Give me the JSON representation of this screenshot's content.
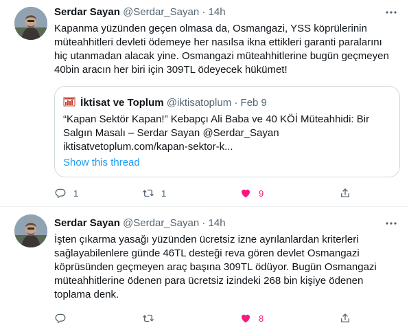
{
  "tweets": [
    {
      "author": "Serdar Sayan",
      "handle": "@Serdar_Sayan",
      "separator": "·",
      "time": "14h",
      "text": "Kapanma yüzünden geçen olmasa da, Osmangazi, YSS köprülerinin\nmüteahhitleri devleti ödemeye her nasılsa ikna ettikleri garanti paralarını\nhiç utanmadan alacak yine. Osmangazi müteahhitlerine bugün geçmeyen\n40bin aracın her biri için 309TL ödeyecek hükümet!",
      "quote": {
        "author": "İktisat ve Toplum",
        "handle": "@iktisatoplum",
        "separator": "·",
        "time": "Feb 9",
        "text": "“Kapan Sektör Kapan!” Kebapçı Ali Baba ve 40 KÖİ Müteahhidi: Bir\nSalgın Masalı – Serdar Sayan @Serdar_Sayan\niktisatvetoplum.com/kapan-sektor-k...",
        "thread_link": "Show this thread"
      },
      "reply_count": "1",
      "retweet_count": "1",
      "like_count": "9"
    },
    {
      "author": "Serdar Sayan",
      "handle": "@Serdar_Sayan",
      "separator": "·",
      "time": "14h",
      "text": "İşten çıkarma yasağı yüzünden ücretsiz izne ayrılanlardan kriterleri\nsağlayabilenlere günde 46TL desteği reva gören devlet Osmangazi\nköprüsünden geçmeyen araç başına 309TL ödüyor. Bugün Osmangazi\nmüteahhitlerine ödenen para ücretsiz izindeki 268 bin kişiye ödenen\ntoplama denk.",
      "reply_count": "",
      "retweet_count": "",
      "like_count": "8"
    }
  ],
  "icons": {
    "more": "more-horizontal-icon",
    "reply": "reply-icon",
    "retweet": "retweet-icon",
    "like": "heart-filled-icon",
    "share": "share-icon"
  },
  "colors": {
    "text": "#0f1419",
    "secondary": "#536471",
    "link": "#1d9bf0",
    "like": "#f91880",
    "border": "#cfd9de"
  }
}
